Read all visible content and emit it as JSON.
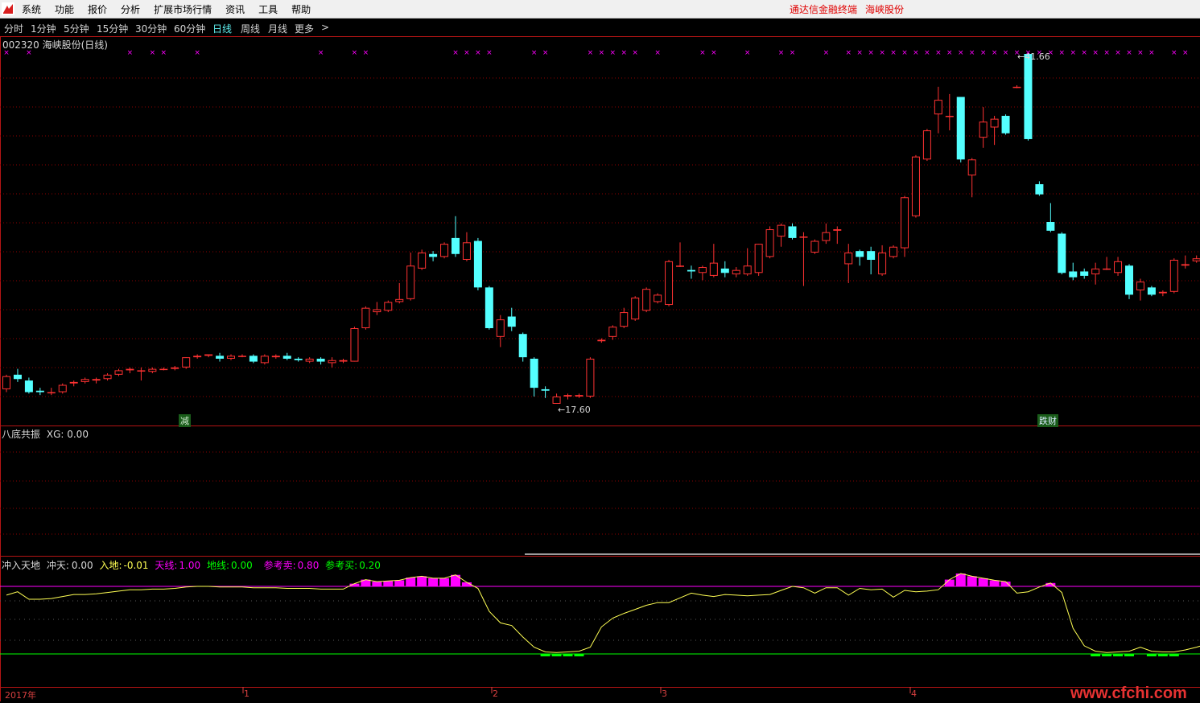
{
  "menu": {
    "items": [
      "系统",
      "功能",
      "报价",
      "分析",
      "扩展市场行情",
      "资讯",
      "工具",
      "帮助"
    ],
    "right_title": "通达信金融终端",
    "right_stock": "海峡股份"
  },
  "periods": {
    "items": [
      "分时",
      "1分钟",
      "5分钟",
      "15分钟",
      "30分钟",
      "60分钟",
      "日线",
      "周线",
      "月线",
      "更多"
    ],
    "active": "日线",
    "more_arrow": ">"
  },
  "main_panel": {
    "title": "002320 海峡股份(日线)",
    "high_label": "41.66",
    "low_label": "17.60",
    "signal_left": "减",
    "signal_right": "跌财"
  },
  "panel2": {
    "name": "八底共振",
    "xg_label": "XG:",
    "xg_value": "0.00"
  },
  "panel3": {
    "name": "冲入天地",
    "chongtian_label": "冲天:",
    "chongtian_value": "0.00",
    "rudi_label": "入地:",
    "rudi_value": "-0.01",
    "tianxian_label": "天线:",
    "tianxian_value": "1.00",
    "dixian_label": "地线:",
    "dixian_value": "0.00",
    "sell_label": "参考卖:",
    "sell_value": "0.80",
    "buy_label": "参考买:",
    "buy_value": "0.20"
  },
  "time_axis": {
    "year_label": "2017年",
    "month_labels": [
      "1",
      "2",
      "3",
      "4"
    ]
  },
  "watermark": "www.cfchi.com",
  "colors": {
    "up": "#ff3232",
    "down": "#54ffff",
    "grid": "#8b0000",
    "yellow_line": "#ffff54",
    "magenta": "#ff00ff",
    "green": "#00ff00",
    "menu_red": "#e00000",
    "active_period": "#5ff0f0"
  },
  "chart_data": {
    "type": "candlestick",
    "price_range": [
      17.6,
      41.66
    ],
    "candles": [
      {
        "o": 18.6,
        "c": 19.5,
        "h": 19.6,
        "l": 18.4
      },
      {
        "o": 19.6,
        "c": 19.3,
        "h": 20.0,
        "l": 19.1
      },
      {
        "o": 19.2,
        "c": 18.4,
        "h": 19.4,
        "l": 18.3
      },
      {
        "o": 18.5,
        "c": 18.4,
        "h": 18.7,
        "l": 18.2
      },
      {
        "o": 18.4,
        "c": 18.4,
        "h": 18.7,
        "l": 18.2
      },
      {
        "o": 18.4,
        "c": 18.9,
        "h": 19.0,
        "l": 18.3
      },
      {
        "o": 19.0,
        "c": 19.1,
        "h": 19.2,
        "l": 18.8
      },
      {
        "o": 19.1,
        "c": 19.3,
        "h": 19.4,
        "l": 19.0
      },
      {
        "o": 19.2,
        "c": 19.3,
        "h": 19.4,
        "l": 19.0
      },
      {
        "o": 19.3,
        "c": 19.6,
        "h": 19.7,
        "l": 19.2
      },
      {
        "o": 19.6,
        "c": 19.9,
        "h": 20.0,
        "l": 19.5
      },
      {
        "o": 19.9,
        "c": 20.0,
        "h": 20.1,
        "l": 19.7
      },
      {
        "o": 19.9,
        "c": 19.9,
        "h": 20.1,
        "l": 19.2
      },
      {
        "o": 19.8,
        "c": 20.0,
        "h": 20.1,
        "l": 19.7
      },
      {
        "o": 20.0,
        "c": 20.0,
        "h": 20.1,
        "l": 19.9
      },
      {
        "o": 20.0,
        "c": 20.1,
        "h": 20.2,
        "l": 19.9
      },
      {
        "o": 20.1,
        "c": 20.8,
        "h": 20.8,
        "l": 20.0
      },
      {
        "o": 20.8,
        "c": 20.9,
        "h": 21.0,
        "l": 20.7
      },
      {
        "o": 20.9,
        "c": 21.0,
        "h": 21.0,
        "l": 20.8
      },
      {
        "o": 20.9,
        "c": 20.7,
        "h": 21.1,
        "l": 20.5
      },
      {
        "o": 20.7,
        "c": 20.9,
        "h": 21.0,
        "l": 20.6
      },
      {
        "o": 20.9,
        "c": 20.9,
        "h": 21.0,
        "l": 20.8
      },
      {
        "o": 20.9,
        "c": 20.5,
        "h": 21.0,
        "l": 20.4
      },
      {
        "o": 20.4,
        "c": 20.9,
        "h": 21.0,
        "l": 20.3
      },
      {
        "o": 20.8,
        "c": 20.9,
        "h": 21.0,
        "l": 20.7
      },
      {
        "o": 20.9,
        "c": 20.7,
        "h": 21.1,
        "l": 20.6
      },
      {
        "o": 20.7,
        "c": 20.6,
        "h": 20.8,
        "l": 20.5
      },
      {
        "o": 20.5,
        "c": 20.7,
        "h": 20.8,
        "l": 20.4
      },
      {
        "o": 20.7,
        "c": 20.5,
        "h": 20.8,
        "l": 20.3
      },
      {
        "o": 20.4,
        "c": 20.6,
        "h": 20.8,
        "l": 20.1
      },
      {
        "o": 20.5,
        "c": 20.6,
        "h": 20.7,
        "l": 20.4
      },
      {
        "o": 20.5,
        "c": 22.8,
        "h": 22.9,
        "l": 20.5
      },
      {
        "o": 22.8,
        "c": 24.2,
        "h": 24.3,
        "l": 22.7
      },
      {
        "o": 23.9,
        "c": 24.1,
        "h": 24.6,
        "l": 23.7
      },
      {
        "o": 24.0,
        "c": 24.6,
        "h": 24.7,
        "l": 23.9
      },
      {
        "o": 24.6,
        "c": 24.8,
        "h": 25.9,
        "l": 24.5
      },
      {
        "o": 24.8,
        "c": 27.1,
        "h": 28.0,
        "l": 24.7
      },
      {
        "o": 26.9,
        "c": 28.0,
        "h": 28.2,
        "l": 26.8
      },
      {
        "o": 27.9,
        "c": 27.7,
        "h": 28.1,
        "l": 27.4
      },
      {
        "o": 27.7,
        "c": 28.6,
        "h": 28.7,
        "l": 27.6
      },
      {
        "o": 29.0,
        "c": 27.9,
        "h": 30.5,
        "l": 27.7
      },
      {
        "o": 27.5,
        "c": 28.7,
        "h": 29.4,
        "l": 27.4
      },
      {
        "o": 28.8,
        "c": 25.6,
        "h": 29.0,
        "l": 25.4
      },
      {
        "o": 25.6,
        "c": 22.8,
        "h": 25.7,
        "l": 22.7
      },
      {
        "o": 22.2,
        "c": 23.4,
        "h": 23.7,
        "l": 21.5
      },
      {
        "o": 23.6,
        "c": 22.9,
        "h": 24.2,
        "l": 22.6
      },
      {
        "o": 22.4,
        "c": 20.8,
        "h": 22.5,
        "l": 20.5
      },
      {
        "o": 20.7,
        "c": 18.7,
        "h": 20.8,
        "l": 18.1
      },
      {
        "o": 18.6,
        "c": 18.5,
        "h": 18.8,
        "l": 18.0
      },
      {
        "o": 17.6,
        "c": 18.1,
        "h": 18.3,
        "l": 17.6
      },
      {
        "o": 18.1,
        "c": 18.2,
        "h": 18.3,
        "l": 17.9
      },
      {
        "o": 18.1,
        "c": 18.2,
        "h": 18.3,
        "l": 18.0
      },
      {
        "o": 18.1,
        "c": 20.7,
        "h": 20.8,
        "l": 18.0
      },
      {
        "o": 21.9,
        "c": 22.0,
        "h": 22.1,
        "l": 21.8
      },
      {
        "o": 22.2,
        "c": 22.9,
        "h": 23.0,
        "l": 22.0
      },
      {
        "o": 22.9,
        "c": 23.9,
        "h": 24.2,
        "l": 22.8
      },
      {
        "o": 23.4,
        "c": 24.9,
        "h": 25.0,
        "l": 23.3
      },
      {
        "o": 24.0,
        "c": 25.5,
        "h": 25.6,
        "l": 23.9
      },
      {
        "o": 24.6,
        "c": 25.1,
        "h": 25.2,
        "l": 24.5
      },
      {
        "o": 24.4,
        "c": 27.4,
        "h": 27.5,
        "l": 24.3
      },
      {
        "o": 27.1,
        "c": 27.1,
        "h": 28.7,
        "l": 27.0
      },
      {
        "o": 26.8,
        "c": 26.7,
        "h": 27.1,
        "l": 26.2
      },
      {
        "o": 26.6,
        "c": 27.0,
        "h": 27.1,
        "l": 26.1
      },
      {
        "o": 26.4,
        "c": 27.3,
        "h": 28.6,
        "l": 26.3
      },
      {
        "o": 26.9,
        "c": 26.6,
        "h": 27.4,
        "l": 26.3
      },
      {
        "o": 26.5,
        "c": 26.8,
        "h": 27.0,
        "l": 26.3
      },
      {
        "o": 26.5,
        "c": 27.1,
        "h": 28.3,
        "l": 26.4
      },
      {
        "o": 26.6,
        "c": 28.6,
        "h": 28.6,
        "l": 26.4
      },
      {
        "o": 27.7,
        "c": 29.6,
        "h": 29.8,
        "l": 27.6
      },
      {
        "o": 29.1,
        "c": 29.9,
        "h": 30.0,
        "l": 28.4
      },
      {
        "o": 29.8,
        "c": 29.0,
        "h": 30.0,
        "l": 28.9
      },
      {
        "o": 29.1,
        "c": 29.1,
        "h": 29.4,
        "l": 25.7
      },
      {
        "o": 28.0,
        "c": 28.8,
        "h": 28.9,
        "l": 27.9
      },
      {
        "o": 28.8,
        "c": 29.4,
        "h": 30.0,
        "l": 28.6
      },
      {
        "o": 29.5,
        "c": 29.6,
        "h": 29.8,
        "l": 28.6
      },
      {
        "o": 27.2,
        "c": 28.0,
        "h": 28.6,
        "l": 25.9
      },
      {
        "o": 28.1,
        "c": 27.7,
        "h": 28.2,
        "l": 27.1
      },
      {
        "o": 28.1,
        "c": 27.5,
        "h": 28.4,
        "l": 26.5
      },
      {
        "o": 26.5,
        "c": 28.0,
        "h": 28.5,
        "l": 26.4
      },
      {
        "o": 27.7,
        "c": 28.4,
        "h": 28.5,
        "l": 27.6
      },
      {
        "o": 28.3,
        "c": 31.8,
        "h": 31.9,
        "l": 27.7
      },
      {
        "o": 30.5,
        "c": 34.6,
        "h": 34.7,
        "l": 30.4
      },
      {
        "o": 34.4,
        "c": 36.4,
        "h": 36.5,
        "l": 34.3
      },
      {
        "o": 37.5,
        "c": 38.5,
        "h": 39.4,
        "l": 36.2
      },
      {
        "o": 37.4,
        "c": 37.4,
        "h": 38.9,
        "l": 36.4
      },
      {
        "o": 38.7,
        "c": 34.4,
        "h": 38.7,
        "l": 34.2
      },
      {
        "o": 33.3,
        "c": 34.4,
        "h": 34.5,
        "l": 31.8
      },
      {
        "o": 35.9,
        "c": 37.0,
        "h": 38.0,
        "l": 35.2
      },
      {
        "o": 36.6,
        "c": 37.2,
        "h": 37.4,
        "l": 35.4
      },
      {
        "o": 37.4,
        "c": 36.2,
        "h": 37.5,
        "l": 36.1
      },
      {
        "o": 39.4,
        "c": 39.4,
        "h": 39.5,
        "l": 39.3
      },
      {
        "o": 41.66,
        "c": 35.8,
        "h": 41.66,
        "l": 35.7
      },
      {
        "o": 32.7,
        "c": 32.0,
        "h": 32.9,
        "l": 31.9
      },
      {
        "o": 30.1,
        "c": 29.5,
        "h": 31.4,
        "l": 29.4
      },
      {
        "o": 29.3,
        "c": 26.6,
        "h": 29.4,
        "l": 26.5
      },
      {
        "o": 26.7,
        "c": 26.3,
        "h": 27.3,
        "l": 26.1
      },
      {
        "o": 26.7,
        "c": 26.4,
        "h": 26.9,
        "l": 26.2
      },
      {
        "o": 26.5,
        "c": 26.9,
        "h": 27.3,
        "l": 25.8
      },
      {
        "o": 26.9,
        "c": 26.9,
        "h": 27.7,
        "l": 26.8
      },
      {
        "o": 26.6,
        "c": 27.4,
        "h": 27.7,
        "l": 26.4
      },
      {
        "o": 27.1,
        "c": 25.1,
        "h": 27.2,
        "l": 24.8
      },
      {
        "o": 25.4,
        "c": 26.0,
        "h": 26.2,
        "l": 24.7
      },
      {
        "o": 25.6,
        "c": 25.1,
        "h": 25.7,
        "l": 25.0
      },
      {
        "o": 25.2,
        "c": 25.3,
        "h": 25.4,
        "l": 25.0
      },
      {
        "o": 25.3,
        "c": 27.5,
        "h": 27.6,
        "l": 25.2
      },
      {
        "o": 27.1,
        "c": 27.2,
        "h": 27.8,
        "l": 26.9
      },
      {
        "o": 27.4,
        "c": 27.6,
        "h": 27.8,
        "l": 27.3
      },
      {
        "o": 27.2,
        "c": 26.6,
        "h": 27.3,
        "l": 26.5
      },
      {
        "o": 25.9,
        "c": 25.4,
        "h": 26.0,
        "l": 25.3
      }
    ],
    "x_markers": [
      0,
      2,
      11,
      13,
      14,
      17,
      28,
      31,
      32,
      40,
      41,
      42,
      43,
      47,
      48,
      52,
      53,
      54,
      55,
      56,
      58,
      62,
      63,
      66,
      69,
      70,
      73,
      75,
      76,
      77,
      78,
      79,
      80,
      81,
      82,
      83,
      84,
      85,
      86,
      87,
      88,
      89,
      90,
      91,
      92,
      93,
      94,
      95,
      96,
      97,
      98,
      99,
      100,
      101,
      102,
      104,
      105
    ],
    "oscillator": {
      "range": [
        0,
        1
      ],
      "values": [
        0.87,
        0.92,
        0.81,
        0.81,
        0.82,
        0.85,
        0.88,
        0.88,
        0.89,
        0.91,
        0.93,
        0.95,
        0.95,
        0.96,
        0.96,
        0.97,
        0.99,
        1.0,
        1.0,
        0.99,
        0.99,
        0.99,
        0.98,
        0.98,
        0.98,
        0.97,
        0.97,
        0.97,
        0.96,
        0.96,
        0.96,
        1.04,
        1.1,
        1.07,
        1.08,
        1.09,
        1.13,
        1.15,
        1.12,
        1.12,
        1.17,
        1.06,
        0.97,
        0.63,
        0.46,
        0.42,
        0.25,
        0.1,
        0.03,
        0.02,
        0.03,
        0.04,
        0.1,
        0.4,
        0.53,
        0.6,
        0.66,
        0.72,
        0.76,
        0.76,
        0.83,
        0.9,
        0.87,
        0.85,
        0.88,
        0.87,
        0.86,
        0.87,
        0.88,
        0.94,
        1.0,
        0.98,
        0.9,
        0.98,
        0.98,
        0.87,
        0.97,
        0.95,
        0.96,
        0.84,
        0.94,
        0.92,
        0.93,
        0.95,
        1.1,
        1.19,
        1.15,
        1.12,
        1.09,
        1.07,
        0.9,
        0.92,
        0.99,
        1.05,
        0.91,
        0.38,
        0.12,
        0.04,
        0.02,
        0.03,
        0.04,
        0.1,
        0.04,
        0.03,
        0.03,
        0.06,
        0.1,
        0.15,
        0.08
      ]
    }
  }
}
